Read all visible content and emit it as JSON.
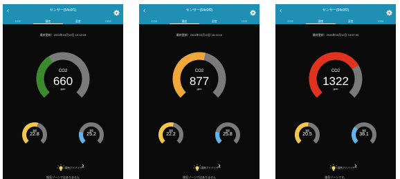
{
  "colors": {
    "nav": "#1f8fb3",
    "background": "#0b0b0b",
    "track": "#7a7a7a",
    "co2_green": "#3c8a2e",
    "co2_orange": "#f0a73a",
    "co2_red": "#e1311f",
    "temp": "#f3c64b",
    "humidity": "#5fb4ea"
  },
  "icons": {
    "back": "chevron-left-icon",
    "settings": "gear-icon",
    "advice": "lightbulb-icon",
    "advice_more": "chevron-right-icon"
  },
  "panels": [
    {
      "nav_title": "センサー(54c0f1)",
      "tabs": [
        "CO2",
        "温度",
        "湿度",
        "CO2"
      ],
      "active_tab": 1,
      "updated": "最終更新：2024年03月10日 15:12:09",
      "co2": {
        "label": "CO2",
        "value": "660",
        "unit": "ppm",
        "fraction": 0.38,
        "color": "#3c8a2e"
      },
      "temp": {
        "label": "温度",
        "value": "22.8",
        "fraction": 0.56
      },
      "humidity": {
        "label": "湿度",
        "value": "25.2",
        "fraction": 0.22
      },
      "advice": "換気アドバイザー",
      "status": "換気ゾーンではありません"
    },
    {
      "nav_title": "センサー(54c0f0)",
      "tabs": [
        "CO2",
        "温度",
        "湿度",
        "CO2"
      ],
      "active_tab": 1,
      "updated": "最終更新：2024年03月10日 15:15:10",
      "co2": {
        "label": "CO2",
        "value": "877",
        "unit": "ppm",
        "fraction": 0.55,
        "color": "#f0a73a"
      },
      "temp": {
        "label": "温度",
        "value": "22.2",
        "fraction": 0.55
      },
      "humidity": {
        "label": "湿度",
        "value": "25.8",
        "fraction": 0.22
      },
      "advice": "換気アドバイザー",
      "status": "換気ゾーンではありません"
    },
    {
      "nav_title": "センサー(54c0f2)",
      "tabs": [
        "CO2",
        "温度",
        "湿度",
        "CO2"
      ],
      "active_tab": 1,
      "updated": "最終更新：2024年03月10日 15:07:39",
      "co2": {
        "label": "CO2",
        "value": "1322",
        "unit": "ppm",
        "fraction": 0.72,
        "color": "#e1311f"
      },
      "temp": {
        "label": "温度",
        "value": "20.5",
        "fraction": 0.52
      },
      "humidity": {
        "label": "湿度",
        "value": "38.1",
        "fraction": 0.32
      },
      "advice": "換気アドバイザー",
      "status": "換気ゾーンです。"
    }
  ]
}
